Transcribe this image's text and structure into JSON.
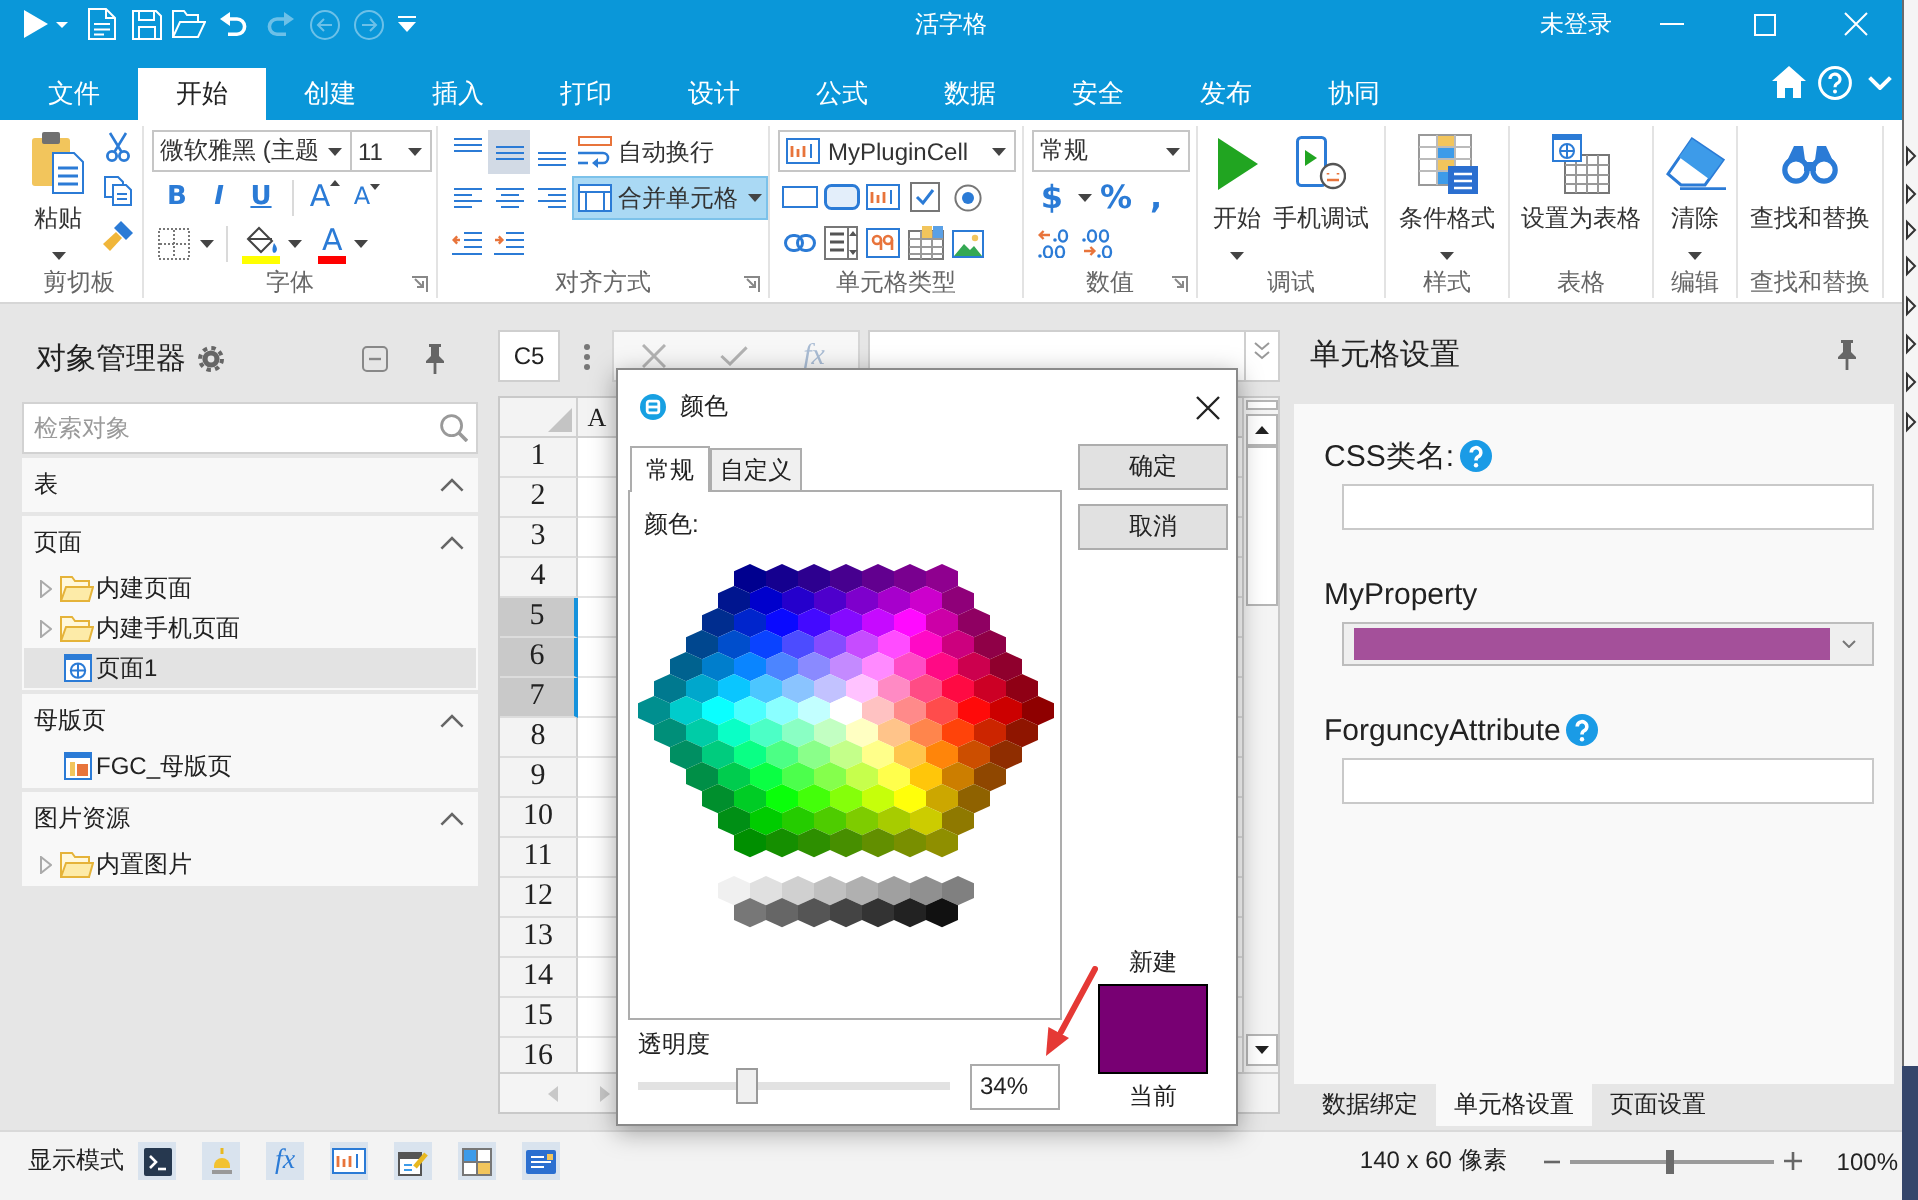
{
  "title_bar": {
    "quick_access_buttons": [
      {
        "disabled": false
      },
      {
        "disabled": false
      },
      {
        "disabled": false
      },
      {
        "disabled": false
      },
      {
        "disabled": false
      },
      {
        "disabled": true
      },
      {
        "disabled": true
      },
      {
        "disabled": true
      },
      {
        "disabled": false
      }
    ],
    "title": "活字格",
    "account": "未登录"
  },
  "tabs": [
    {
      "label": "文件",
      "selected": false
    },
    {
      "label": "开始",
      "selected": true
    },
    {
      "label": "创建",
      "selected": false
    },
    {
      "label": "插入",
      "selected": false
    },
    {
      "label": "打印",
      "selected": false
    },
    {
      "label": "设计",
      "selected": false
    },
    {
      "label": "公式",
      "selected": false
    },
    {
      "label": "数据",
      "selected": false
    },
    {
      "label": "安全",
      "selected": false
    },
    {
      "label": "发布",
      "selected": false
    },
    {
      "label": "协同",
      "selected": false
    }
  ],
  "ribbon": {
    "groups": [
      {
        "kind": "clipboard",
        "label": "剪切板",
        "paste": {
          "label": "粘贴",
          "has_menu": true
        }
      },
      {
        "kind": "font",
        "label": "字体",
        "font_name": "微软雅黑 (主题",
        "font_size": "11",
        "style_buttons": [
          "B",
          "I",
          "U"
        ],
        "size_buttons": [
          "A",
          "A"
        ],
        "font_color_label": "A"
      },
      {
        "kind": "alignment",
        "label": "对齐方式",
        "vertical_buttons": [
          {
            "selected": false
          },
          {
            "selected": true
          },
          {
            "selected": false
          }
        ],
        "horizontal_buttons": [
          {
            "selected": false
          },
          {
            "selected": false
          },
          {
            "selected": false
          }
        ],
        "wrap": {
          "label": "自动换行",
          "selected": false
        },
        "merge": {
          "label": "合并单元格",
          "selected": true
        }
      },
      {
        "kind": "cell_type",
        "label": "单元格类型",
        "value": "MyPluginCell"
      },
      {
        "kind": "number",
        "label": "数值",
        "format": "常规",
        "symbol_buttons": [
          "$",
          "%",
          ","
        ]
      },
      {
        "kind": "large",
        "label": "调试",
        "buttons": [
          {
            "label": "开始",
            "has_menu": true
          },
          {
            "label": "手机调试",
            "has_menu": false
          }
        ]
      },
      {
        "kind": "large",
        "label": "样式",
        "buttons": [
          {
            "label": "条件格式",
            "has_menu": true
          }
        ]
      },
      {
        "kind": "large",
        "label": "表格",
        "buttons": [
          {
            "label": "设置为表格",
            "has_menu": false
          }
        ]
      },
      {
        "kind": "large",
        "label": "编辑",
        "buttons": [
          {
            "label": "清除",
            "has_menu": true
          }
        ]
      },
      {
        "kind": "large",
        "label": "查找和替换",
        "buttons": [
          {
            "label": "查找和替换",
            "has_menu": false
          }
        ]
      }
    ]
  },
  "object_manager": {
    "title": "对象管理器",
    "search": {
      "placeholder": "检索对象"
    },
    "sections": [
      {
        "title": "表",
        "expanded": true
      },
      {
        "title": "页面",
        "expanded": true,
        "items": [
          {
            "label": "内建页面",
            "kind": "folder",
            "expanded": false,
            "selected": false
          },
          {
            "label": "内建手机页面",
            "kind": "folder",
            "expanded": false,
            "selected": false
          },
          {
            "label": "页面1",
            "kind": "page",
            "selected": true
          }
        ]
      },
      {
        "title": "母版页",
        "expanded": true,
        "items": [
          {
            "label": "FGC_母版页",
            "kind": "master_page",
            "selected": false
          }
        ]
      },
      {
        "title": "图片资源",
        "expanded": true,
        "items": [
          {
            "label": "内置图片",
            "kind": "folder",
            "expanded": false,
            "selected": false
          }
        ]
      }
    ]
  },
  "sheet": {
    "name_box": "C5",
    "function_label": "fx",
    "column_headers": [
      "A"
    ],
    "rows": [
      {
        "label": "1",
        "selected": false
      },
      {
        "label": "2",
        "selected": false
      },
      {
        "label": "3",
        "selected": false
      },
      {
        "label": "4",
        "selected": false
      },
      {
        "label": "5",
        "selected": true
      },
      {
        "label": "6",
        "selected": true
      },
      {
        "label": "7",
        "selected": true
      },
      {
        "label": "8",
        "selected": false
      },
      {
        "label": "9",
        "selected": false
      },
      {
        "label": "10",
        "selected": false
      },
      {
        "label": "11",
        "selected": false
      },
      {
        "label": "12",
        "selected": false
      },
      {
        "label": "13",
        "selected": false
      },
      {
        "label": "14",
        "selected": false
      },
      {
        "label": "15",
        "selected": false
      },
      {
        "label": "16",
        "selected": false
      }
    ]
  },
  "color_dialog": {
    "title": "颜色",
    "tabs": [
      {
        "label": "常规",
        "selected": true
      },
      {
        "label": "自定义",
        "selected": false
      }
    ],
    "colors_label": "颜色:",
    "buttons": [
      "确定",
      "取消"
    ],
    "transparency": {
      "label": "透明度",
      "level": 0.34,
      "value": "34%"
    },
    "preview": {
      "new_label": "新建",
      "current_label": "当前",
      "color": "#780073"
    }
  },
  "cell_settings": {
    "title": "单元格设置",
    "properties": [
      {
        "label": "CSS类名:",
        "kind": "text",
        "help": true
      },
      {
        "label": "MyProperty",
        "kind": "color",
        "help": false,
        "color": "#a4509a"
      },
      {
        "label": "ForguncyAttribute",
        "kind": "text",
        "help": true
      }
    ],
    "tabs": [
      {
        "label": "数据绑定",
        "selected": false
      },
      {
        "label": "单元格设置",
        "selected": true
      },
      {
        "label": "页面设置",
        "selected": false
      }
    ]
  },
  "status_bar": {
    "mode_label": "显示模式",
    "function_label": "fx",
    "size": "140 x 60 像素",
    "zoom": {
      "level": 0.49,
      "value": "100%"
    }
  }
}
